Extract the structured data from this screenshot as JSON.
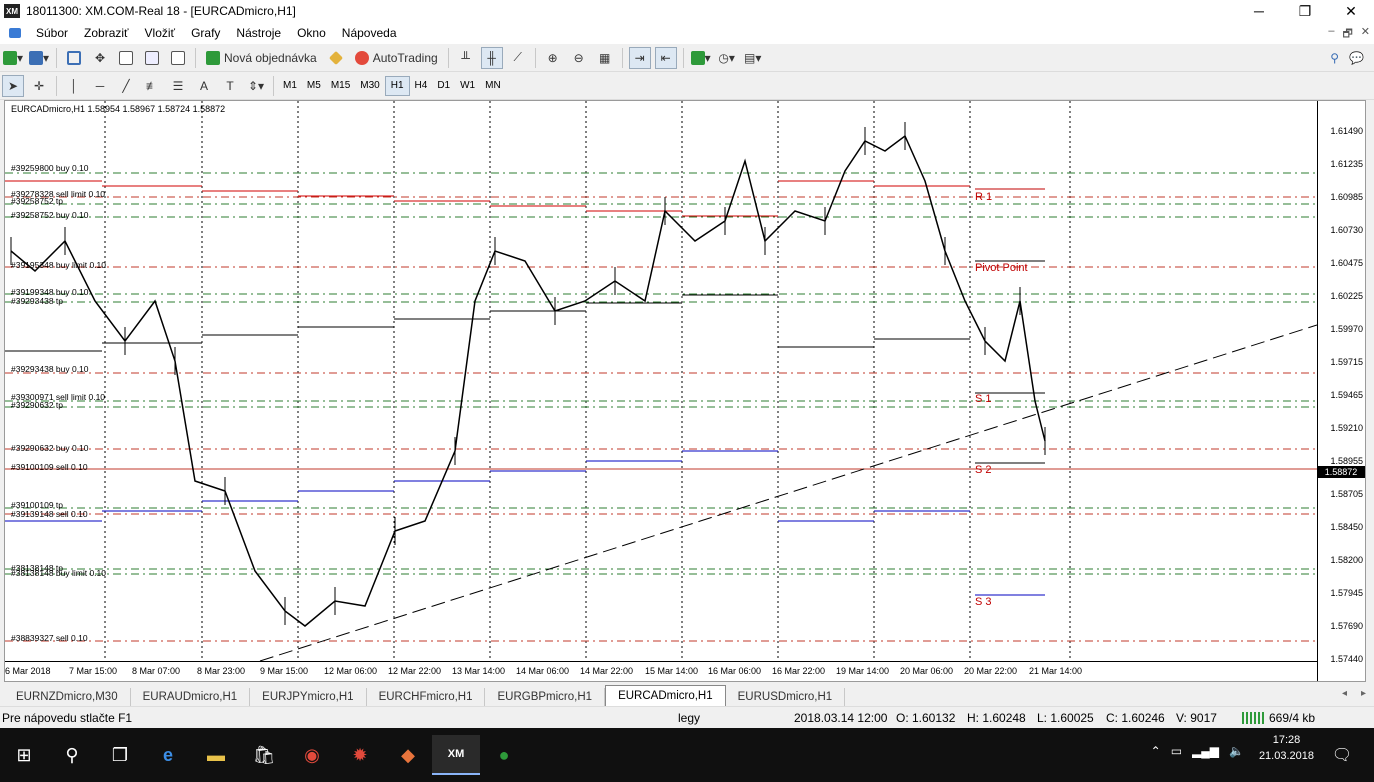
{
  "window": {
    "title": "18011300: XM.COM-Real 18 - [EURCADmicro,H1]",
    "minimize": "─",
    "maximize": "❐",
    "close": "✕"
  },
  "menu": {
    "items": [
      "Súbor",
      "Zobraziť",
      "Vložiť",
      "Grafy",
      "Nástroje",
      "Okno",
      "Nápoveda"
    ],
    "right_controls": [
      "–",
      "🗗",
      "✕"
    ]
  },
  "toolbar1": {
    "new_order": "Nová objednávka",
    "autotrading": "AutoTrading"
  },
  "toolbar2": {
    "timeframes": [
      "M1",
      "M5",
      "M15",
      "M30",
      "H1",
      "H4",
      "D1",
      "W1",
      "MN"
    ],
    "active_timeframe": "H1"
  },
  "chart": {
    "label": "EURCADmicro,H1  1.58954 1.58967 1.58724 1.58872",
    "current_price": "1.58872",
    "price_ticks": [
      "1.61490",
      "1.61235",
      "1.60985",
      "1.60730",
      "1.60475",
      "1.60225",
      "1.59970",
      "1.59715",
      "1.59465",
      "1.59210",
      "1.58955",
      "1.58705",
      "1.58450",
      "1.58200",
      "1.57945",
      "1.57690",
      "1.57440"
    ],
    "time_ticks": [
      "6 Mar 2018",
      "7 Mar 15:00",
      "8 Mar 07:00",
      "8 Mar 23:00",
      "9 Mar 15:00",
      "12 Mar 06:00",
      "12 Mar 22:00",
      "13 Mar 14:00",
      "14 Mar 06:00",
      "14 Mar 22:00",
      "15 Mar 14:00",
      "16 Mar 06:00",
      "16 Mar 22:00",
      "19 Mar 14:00",
      "20 Mar 06:00",
      "20 Mar 22:00",
      "21 Mar 14:00"
    ],
    "order_labels": [
      "#39259800 buy 0.10",
      "#39278328 sell limit 0.10",
      "#39258752 tp",
      "#39258752 buy 0.10",
      "#39195348 buy limit 0.10",
      "#39199348 buy 0.10",
      "#39293438 tp",
      "#39293438 buy 0.10",
      "#39300971 sell limit 0.10",
      "#39290632 tp",
      "#39290632 buy 0.10",
      "#39100109 sell 0.10",
      "#39100109 tp",
      "#39139148 sell 0.10",
      "#38138148 tp",
      "#38138148 buy limit 0.10",
      "#38839327 sell 0.10"
    ],
    "pivot_labels": [
      "R 1",
      "Pivot Point",
      "S 1",
      "S 2",
      "S 3"
    ]
  },
  "tabs": [
    "EURNZDmicro,M30",
    "EURAUDmicro,H1",
    "EURJPYmicro,H1",
    "EURCHFmicro,H1",
    "EURGBPmicro,H1",
    "EURCADmicro,H1",
    "EURUSDmicro,H1"
  ],
  "active_tab": "EURCADmicro,H1",
  "status": {
    "help": "Pre nápovedu stlačte F1",
    "profile": "legy",
    "datetime": "2018.03.14 12:00",
    "open": "O: 1.60132",
    "high": "H: 1.60248",
    "low": "L: 1.60025",
    "close": "C: 1.60246",
    "volume": "V: 9017",
    "traffic": "669/4 kb"
  },
  "taskbar": {
    "time": "17:28",
    "date": "21.03.2018"
  }
}
